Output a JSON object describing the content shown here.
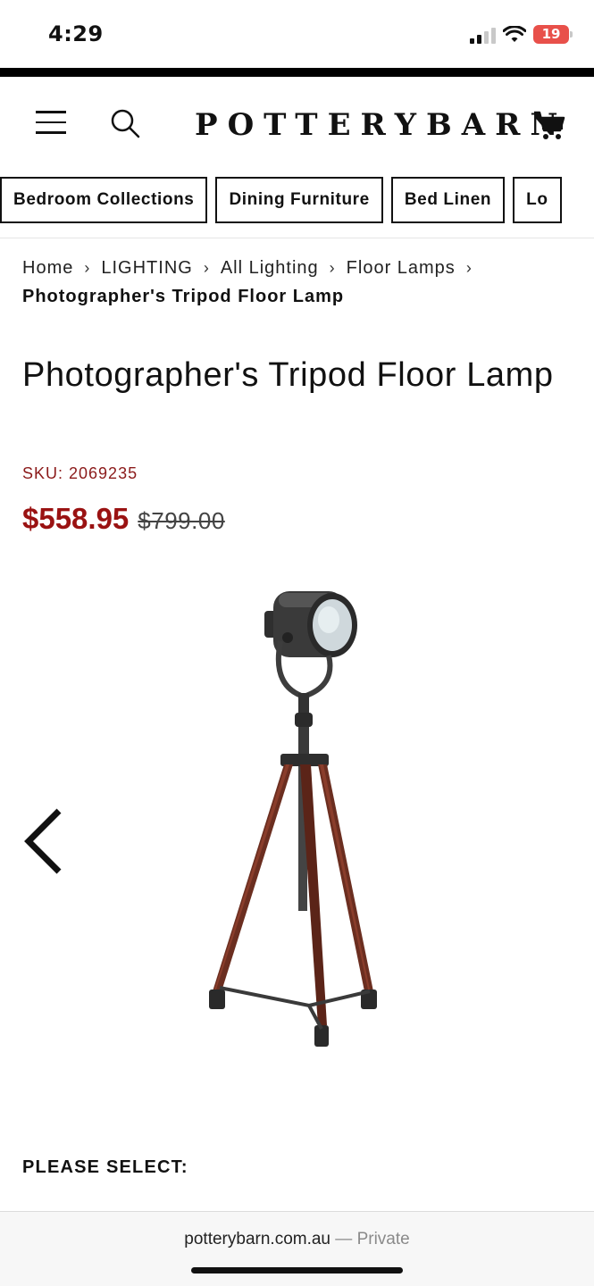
{
  "status_bar": {
    "time": "4:29",
    "battery": "19",
    "icons": [
      "signal-icon",
      "wifi-icon",
      "battery-icon"
    ]
  },
  "header": {
    "logo_main": "POTTERY",
    "logo_second": "BARN",
    "icons": [
      "menu-icon",
      "search-icon",
      "cart-icon"
    ]
  },
  "categories": [
    {
      "label": "Bedroom Collections"
    },
    {
      "label": "Dining Furniture"
    },
    {
      "label": "Bed Linen"
    },
    {
      "label": "Lo"
    }
  ],
  "breadcrumb": {
    "items": [
      "Home",
      "LIGHTING",
      "All Lighting",
      "Floor Lamps"
    ],
    "current": "Photographer's Tripod Floor Lamp"
  },
  "product": {
    "title": "Photographer's Tripod Floor Lamp",
    "sku": "SKU: 2069235",
    "price_sale": "$558.95",
    "price_original": "$799.00",
    "image_icon": "tripod-floor-lamp-image"
  },
  "gallery": {
    "prev_icon": "chevron-left-icon"
  },
  "options": {
    "heading": "PLEASE SELECT:"
  },
  "browser": {
    "url": "potterybarn.com.au",
    "separator": "—",
    "mode": "Private"
  },
  "colors": {
    "sale_red": "#9a1212",
    "sku_red": "#8b1a1a",
    "text": "#111111"
  }
}
